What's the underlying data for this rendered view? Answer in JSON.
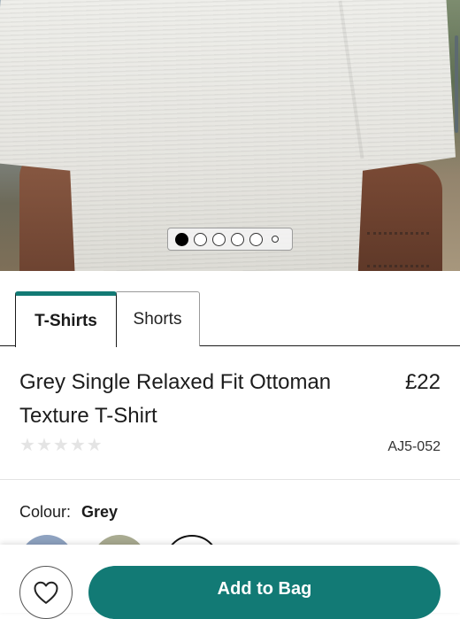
{
  "gallery": {
    "image_alt_icon": "product-photo",
    "dot_count": 6,
    "active_index": 0
  },
  "tabs": [
    {
      "label": "T-Shirts",
      "active": true
    },
    {
      "label": "Shorts",
      "active": false
    }
  ],
  "product": {
    "title": "Grey Single Relaxed Fit Ottoman Texture T-Shirt",
    "price": "£22",
    "sku": "AJ5-052",
    "rating_stars": 5,
    "rating_value": 0
  },
  "colour": {
    "label": "Colour:",
    "selected": "Grey",
    "swatches": [
      "#8ea2c0",
      "#a9ab91",
      "#ffffff"
    ]
  },
  "actions": {
    "add_to_bag": "Add to Bag",
    "wishlist_icon": "heart-icon"
  },
  "colors": {
    "accent": "#127a75",
    "star_empty": "#e4e4e4"
  }
}
